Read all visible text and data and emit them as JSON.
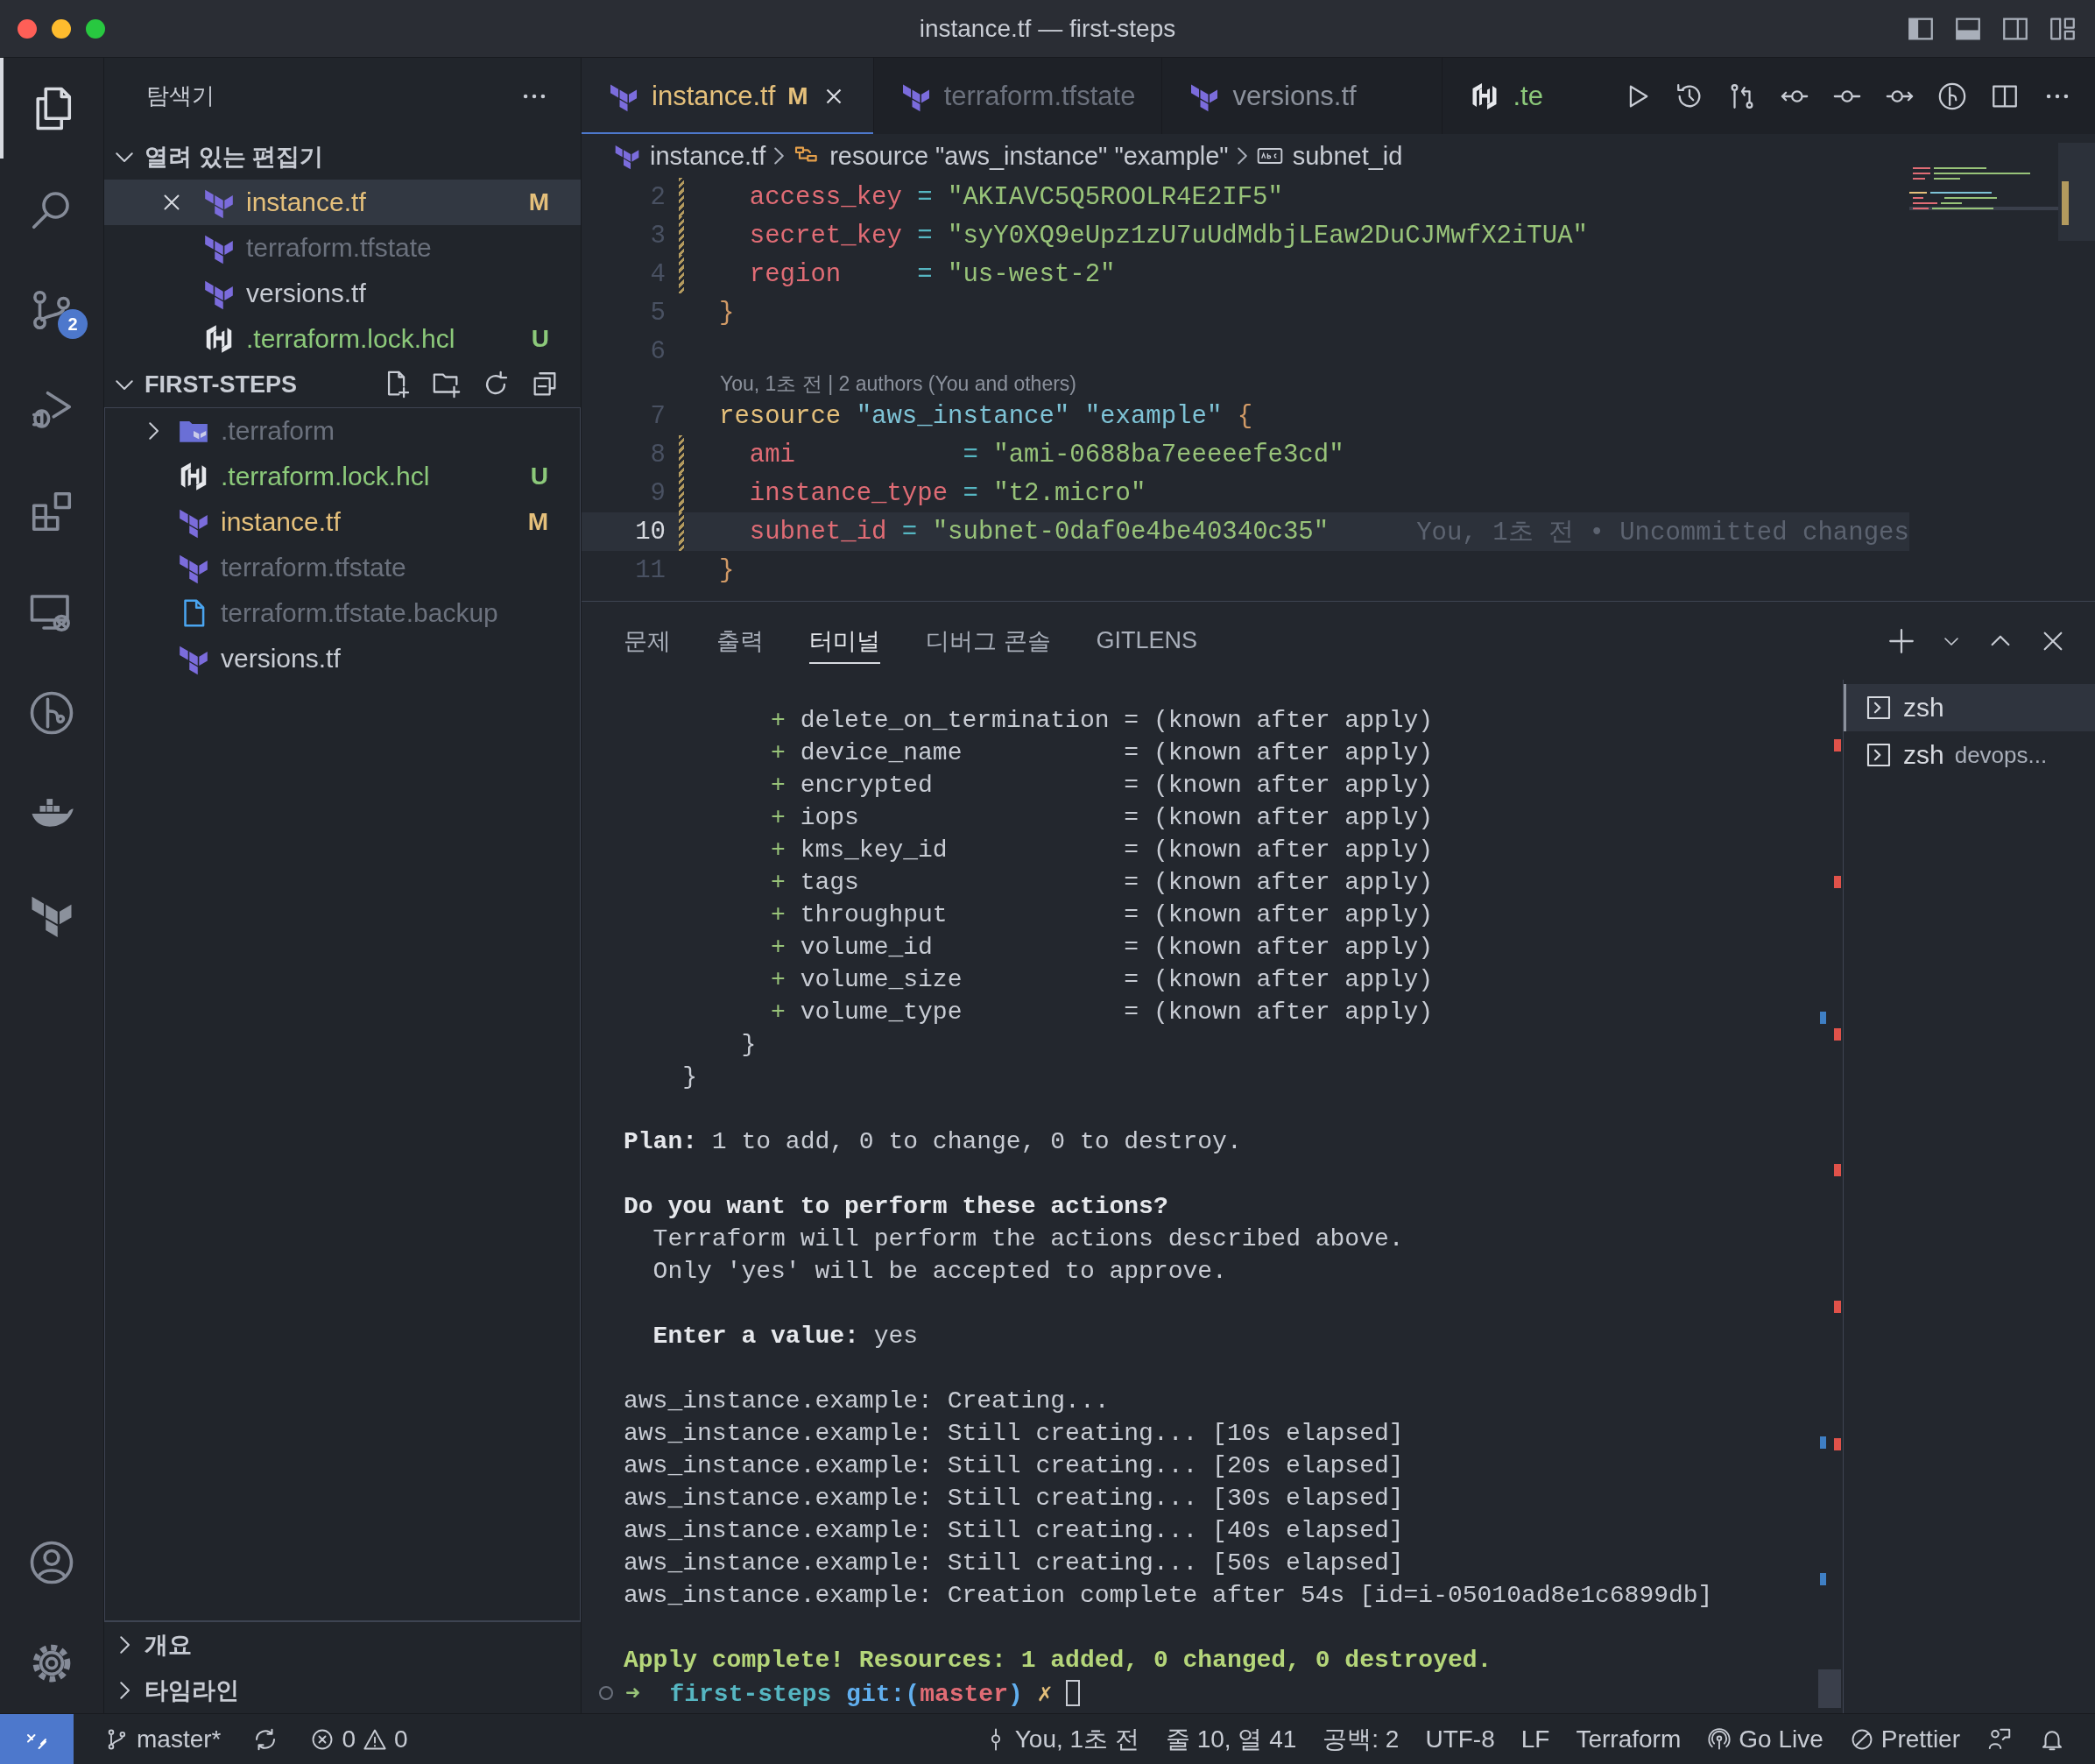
{
  "window": {
    "title": "instance.tf — first-steps"
  },
  "activity_bar": {
    "items": [
      {
        "kind": "explorer",
        "selected": true
      },
      {
        "kind": "search",
        "selected": false
      },
      {
        "kind": "source-control",
        "selected": false,
        "badge": "2"
      },
      {
        "kind": "run-debug",
        "selected": false
      },
      {
        "kind": "extensions",
        "selected": false
      },
      {
        "kind": "remote-explorer",
        "selected": false
      },
      {
        "kind": "gitlens",
        "selected": false
      },
      {
        "kind": "docker",
        "selected": false
      },
      {
        "kind": "terraform",
        "selected": false
      }
    ],
    "bottom_items": [
      {
        "kind": "accounts"
      },
      {
        "kind": "settings"
      }
    ]
  },
  "sidebar": {
    "title": "탐색기",
    "sections": [
      {
        "title": "열려 있는 편집기",
        "kind": "open-editors",
        "expanded": true,
        "items": [
          {
            "name": "instance.tf",
            "kind": "terraform",
            "color": "#e5c07b",
            "badge": "M",
            "selected": true
          },
          {
            "name": "terraform.tfstate",
            "kind": "terraform",
            "color": "#6b717d",
            "selected": false
          },
          {
            "name": "versions.tf",
            "kind": "terraform",
            "color": "#c8ccd4",
            "selected": false
          },
          {
            "name": ".terraform.lock.hcl",
            "kind": "hashicorp",
            "color": "#8cc97a",
            "badge": "U",
            "selected": false
          }
        ]
      },
      {
        "title": "FIRST-STEPS",
        "kind": "folder",
        "expanded": true,
        "items": [
          {
            "name": ".terraform",
            "kind": "folder",
            "color": "#6b717d",
            "expanded": false,
            "selected": false
          },
          {
            "name": ".terraform.lock.hcl",
            "kind": "hashicorp",
            "color": "#8cc97a",
            "badge": "U",
            "selected": false
          },
          {
            "name": "instance.tf",
            "kind": "terraform",
            "color": "#e5c07b",
            "badge": "M",
            "selected": false
          },
          {
            "name": "terraform.tfstate",
            "kind": "terraform",
            "color": "#6b717d",
            "selected": false
          },
          {
            "name": "terraform.tfstate.backup",
            "kind": "file",
            "color": "#6b717d",
            "selected": false
          },
          {
            "name": "versions.tf",
            "kind": "terraform",
            "color": "#c8ccd4",
            "selected": false
          }
        ]
      }
    ],
    "collapsed_sections": [
      {
        "title": "개요",
        "expanded": false
      },
      {
        "title": "타임라인",
        "expanded": false
      }
    ]
  },
  "editor": {
    "tabs": [
      {
        "label": "instance.tf",
        "kind": "terraform",
        "color": "#e5c07b",
        "badge": "M",
        "selected": true
      },
      {
        "label": "terraform.tfstate",
        "kind": "terraform",
        "color": "#6b717d",
        "selected": false
      },
      {
        "label": "versions.tf",
        "kind": "terraform",
        "color": "#8b919c",
        "selected": false
      },
      {
        "label": ".te",
        "kind": "hashicorp",
        "color": "#8cc97a",
        "selected": false
      }
    ],
    "breadcrumbs": [
      {
        "text": "instance.tf",
        "kind": "terraform"
      },
      {
        "text": "resource \"aws_instance\" \"example\"",
        "kind": "module"
      },
      {
        "text": "subnet_id",
        "kind": "string"
      }
    ],
    "lines": [
      {
        "kind": "code",
        "number": "2",
        "changed": true,
        "current": false,
        "tokens": [
          {
            "kind": "property",
            "text": "  access_key"
          },
          {
            "kind": "operator",
            "text": " = "
          },
          {
            "kind": "string",
            "text": "\"AKIAVC5Q5ROOLR4E2IF5\""
          }
        ]
      },
      {
        "kind": "code",
        "number": "3",
        "changed": true,
        "current": false,
        "tokens": [
          {
            "kind": "property",
            "text": "  secret_key"
          },
          {
            "kind": "operator",
            "text": " = "
          },
          {
            "kind": "string",
            "text": "\"syY0XQ9eUpz1zU7uUdMdbjLEaw2DuCJMwfX2iTUA\""
          }
        ]
      },
      {
        "kind": "code",
        "number": "4",
        "changed": true,
        "current": false,
        "tokens": [
          {
            "kind": "property",
            "text": "  region"
          },
          {
            "kind": "operator",
            "text": "     = "
          },
          {
            "kind": "string",
            "text": "\"us-west-2\""
          }
        ]
      },
      {
        "kind": "code",
        "number": "5",
        "changed": false,
        "current": false,
        "tokens": [
          {
            "kind": "brace",
            "text": "}"
          }
        ]
      },
      {
        "kind": "code",
        "number": "6",
        "changed": false,
        "current": false
      },
      {
        "kind": "codelens",
        "text": "You, 1초 전 | 2 authors (You and others)"
      },
      {
        "kind": "code",
        "number": "7",
        "changed": false,
        "current": false,
        "tokens": [
          {
            "kind": "keyword",
            "text": "resource"
          },
          {
            "kind": "label",
            "text": " \"aws_instance\""
          },
          {
            "kind": "label",
            "text": " \"example\""
          },
          {
            "kind": "brace",
            "text": " {"
          }
        ]
      },
      {
        "kind": "code",
        "number": "8",
        "changed": true,
        "current": false,
        "tokens": [
          {
            "kind": "property",
            "text": "  ami"
          },
          {
            "kind": "operator",
            "text": "           = "
          },
          {
            "kind": "string",
            "text": "\"ami-0688ba7eeeeefe3cd\""
          }
        ]
      },
      {
        "kind": "code",
        "number": "9",
        "changed": true,
        "current": false,
        "tokens": [
          {
            "kind": "property",
            "text": "  instance_type"
          },
          {
            "kind": "operator",
            "text": " = "
          },
          {
            "kind": "string",
            "text": "\"t2.micro\""
          }
        ]
      },
      {
        "kind": "code",
        "number": "10",
        "changed": true,
        "current": true,
        "blame": "You, 1초 전 • Uncommitted changes",
        "tokens": [
          {
            "kind": "property",
            "text": "  subnet_id"
          },
          {
            "kind": "operator",
            "text": " = "
          },
          {
            "kind": "string",
            "text": "\"subnet-0daf0e4be40340c35\""
          }
        ]
      },
      {
        "kind": "code",
        "number": "11",
        "changed": false,
        "current": false,
        "tokens": [
          {
            "kind": "brace",
            "text": "}"
          }
        ]
      }
    ]
  },
  "panel": {
    "tabs": [
      {
        "label": "문제",
        "selected": false
      },
      {
        "label": "출력",
        "selected": false
      },
      {
        "label": "터미널",
        "selected": true
      },
      {
        "label": "디버그 콘솔",
        "selected": false
      },
      {
        "label": "GITLENS",
        "selected": false
      }
    ],
    "terminal_blocks": [
      [
        {
          "segments": [
            {
              "kind": "add",
              "text": "          +"
            },
            {
              "kind": "plain",
              "text": " delete_on_termination = (known after apply)"
            }
          ]
        },
        {
          "segments": [
            {
              "kind": "add",
              "text": "          +"
            },
            {
              "kind": "plain",
              "text": " device_name           = (known after apply)"
            }
          ]
        },
        {
          "segments": [
            {
              "kind": "add",
              "text": "          +"
            },
            {
              "kind": "plain",
              "text": " encrypted             = (known after apply)"
            }
          ]
        },
        {
          "segments": [
            {
              "kind": "add",
              "text": "          +"
            },
            {
              "kind": "plain",
              "text": " iops                  = (known after apply)"
            }
          ]
        },
        {
          "segments": [
            {
              "kind": "add",
              "text": "          +"
            },
            {
              "kind": "plain",
              "text": " kms_key_id            = (known after apply)"
            }
          ]
        },
        {
          "segments": [
            {
              "kind": "add",
              "text": "          +"
            },
            {
              "kind": "plain",
              "text": " tags                  = (known after apply)"
            }
          ]
        },
        {
          "segments": [
            {
              "kind": "add",
              "text": "          +"
            },
            {
              "kind": "plain",
              "text": " throughput            = (known after apply)"
            }
          ]
        },
        {
          "segments": [
            {
              "kind": "add",
              "text": "          +"
            },
            {
              "kind": "plain",
              "text": " volume_id             = (known after apply)"
            }
          ]
        },
        {
          "segments": [
            {
              "kind": "add",
              "text": "          +"
            },
            {
              "kind": "plain",
              "text": " volume_size           = (known after apply)"
            }
          ]
        },
        {
          "segments": [
            {
              "kind": "add",
              "text": "          +"
            },
            {
              "kind": "plain",
              "text": " volume_type           = (known after apply)"
            }
          ]
        },
        {
          "segments": [
            {
              "kind": "plain",
              "text": "        }"
            }
          ]
        },
        {
          "segments": [
            {
              "kind": "plain",
              "text": "    }"
            }
          ]
        }
      ],
      [
        {
          "segments": [
            {
              "kind": "bold",
              "text": "Plan:"
            },
            {
              "kind": "plain",
              "text": " 1 to add, 0 to change, 0 to destroy."
            }
          ]
        }
      ],
      [
        {
          "segments": [
            {
              "kind": "bold",
              "text": "Do you want to perform these actions?"
            }
          ]
        },
        {
          "segments": [
            {
              "kind": "plain",
              "text": "  Terraform will perform the actions described above."
            }
          ]
        },
        {
          "segments": [
            {
              "kind": "plain",
              "text": "  Only 'yes' will be accepted to approve."
            }
          ]
        }
      ],
      [
        {
          "segments": [
            {
              "kind": "bold",
              "text": "  Enter a value:"
            },
            {
              "kind": "plain",
              "text": " yes"
            }
          ]
        }
      ],
      [
        {
          "segments": [
            {
              "kind": "plain",
              "text": "aws_instance.example: Creating..."
            }
          ]
        },
        {
          "segments": [
            {
              "kind": "plain",
              "text": "aws_instance.example: Still creating... [10s elapsed]"
            }
          ]
        },
        {
          "segments": [
            {
              "kind": "plain",
              "text": "aws_instance.example: Still creating... [20s elapsed]"
            }
          ]
        },
        {
          "segments": [
            {
              "kind": "plain",
              "text": "aws_instance.example: Still creating... [30s elapsed]"
            }
          ]
        },
        {
          "segments": [
            {
              "kind": "plain",
              "text": "aws_instance.example: Still creating... [40s elapsed]"
            }
          ]
        },
        {
          "segments": [
            {
              "kind": "plain",
              "text": "aws_instance.example: Still creating... [50s elapsed]"
            }
          ]
        },
        {
          "segments": [
            {
              "kind": "plain",
              "text": "aws_instance.example: Creation complete after 54s [id=i-05010ad8e1c6899db]"
            }
          ]
        }
      ],
      [
        {
          "segments": [
            {
              "kind": "success",
              "text": "Apply complete! Resources: 1 added, 0 changed, 0 destroyed."
            }
          ]
        },
        {
          "kind": "prompt",
          "segments": [
            {
              "kind": "prompt-arrow",
              "text": "➜"
            },
            {
              "kind": "prompt-dir",
              "text": "  first-steps"
            },
            {
              "kind": "prompt-git",
              "text": " git:("
            },
            {
              "kind": "prompt-branch",
              "text": "master"
            },
            {
              "kind": "prompt-git",
              "text": ")"
            },
            {
              "kind": "prompt-dirty",
              "text": " ✗"
            }
          ]
        }
      ]
    ],
    "terminals": [
      {
        "name": "zsh",
        "selected": true
      },
      {
        "name": "zsh",
        "detail": "devops...",
        "selected": false
      }
    ]
  },
  "status_bar": {
    "left": [
      {
        "kind": "remote"
      },
      {
        "kind": "branch",
        "text": "master*"
      },
      {
        "kind": "sync"
      },
      {
        "kind": "problems",
        "errors": "0",
        "warnings": "0"
      }
    ],
    "right": [
      {
        "kind": "blame",
        "text": "You, 1초 전"
      },
      {
        "kind": "text",
        "text": "줄 10, 열 41"
      },
      {
        "kind": "text",
        "text": "공백: 2"
      },
      {
        "kind": "text",
        "text": "UTF-8"
      },
      {
        "kind": "text",
        "text": "LF"
      },
      {
        "kind": "text",
        "text": "Terraform"
      },
      {
        "kind": "golive",
        "text": "Go Live"
      },
      {
        "kind": "prettier",
        "text": "Prettier"
      },
      {
        "kind": "feedback"
      },
      {
        "kind": "bell"
      }
    ]
  }
}
